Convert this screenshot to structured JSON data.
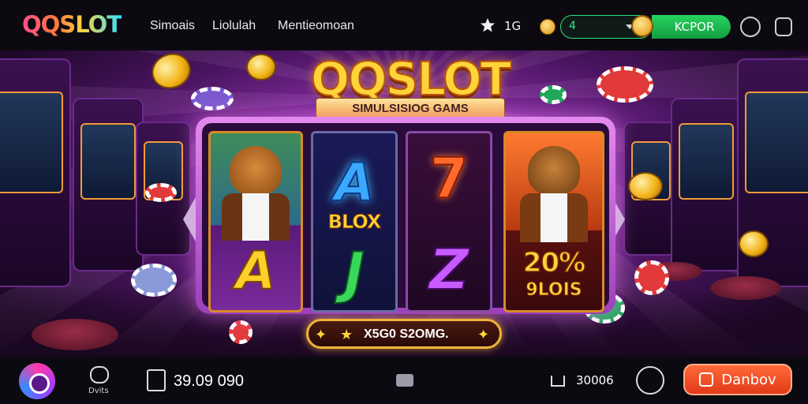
{
  "header": {
    "logo": "QQSLOT",
    "nav": [
      "Simoais",
      "Liolulah",
      "Mentieomoan"
    ],
    "score": "1G",
    "balance_value": "4",
    "kpor_label": "KCPOR",
    "icons": [
      "star-icon",
      "coin-icon",
      "refresh-icon",
      "exit-icon"
    ]
  },
  "hero": {
    "title": "QQSLOT",
    "subtitle": "SIMULSISIOG GAMS"
  },
  "reels": {
    "r2_top": "A",
    "r2_word": "BLOX",
    "r2_bottom": "J",
    "r3_top": "7",
    "r3_bottom": "Z",
    "r1_bottom": "A",
    "r4_pct": "20%",
    "r4_word": "9LOIS"
  },
  "win_banner": "X5G0 S2OMG.",
  "footer": {
    "chat_label": "Dvits",
    "credits": "39.09 090",
    "bet": "30006",
    "deposit_label": "Danbov"
  },
  "colors": {
    "accent_green": "#27d35f",
    "accent_orange": "#ff6a3a",
    "frame_purple": "#c35bdc",
    "gold": "#ffd43a"
  }
}
